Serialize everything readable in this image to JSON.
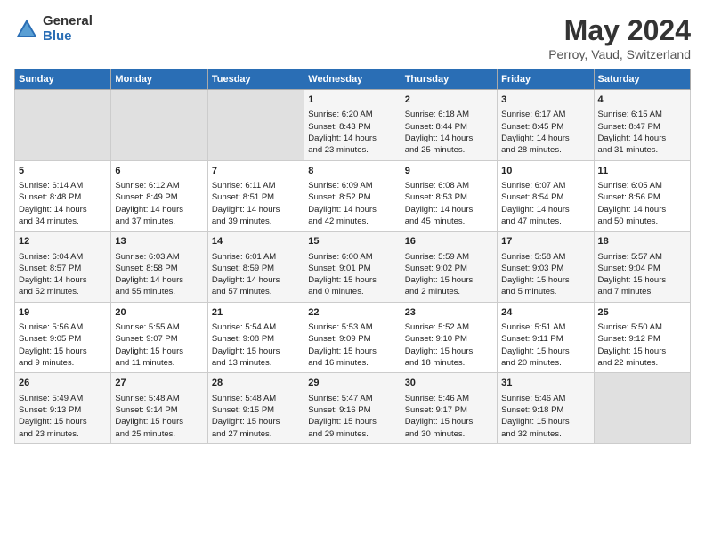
{
  "logo": {
    "general": "General",
    "blue": "Blue"
  },
  "title": "May 2024",
  "subtitle": "Perroy, Vaud, Switzerland",
  "weekdays": [
    "Sunday",
    "Monday",
    "Tuesday",
    "Wednesday",
    "Thursday",
    "Friday",
    "Saturday"
  ],
  "weeks": [
    [
      {
        "day": "",
        "lines": []
      },
      {
        "day": "",
        "lines": []
      },
      {
        "day": "",
        "lines": []
      },
      {
        "day": "1",
        "lines": [
          "Sunrise: 6:20 AM",
          "Sunset: 8:43 PM",
          "Daylight: 14 hours",
          "and 23 minutes."
        ]
      },
      {
        "day": "2",
        "lines": [
          "Sunrise: 6:18 AM",
          "Sunset: 8:44 PM",
          "Daylight: 14 hours",
          "and 25 minutes."
        ]
      },
      {
        "day": "3",
        "lines": [
          "Sunrise: 6:17 AM",
          "Sunset: 8:45 PM",
          "Daylight: 14 hours",
          "and 28 minutes."
        ]
      },
      {
        "day": "4",
        "lines": [
          "Sunrise: 6:15 AM",
          "Sunset: 8:47 PM",
          "Daylight: 14 hours",
          "and 31 minutes."
        ]
      }
    ],
    [
      {
        "day": "5",
        "lines": [
          "Sunrise: 6:14 AM",
          "Sunset: 8:48 PM",
          "Daylight: 14 hours",
          "and 34 minutes."
        ]
      },
      {
        "day": "6",
        "lines": [
          "Sunrise: 6:12 AM",
          "Sunset: 8:49 PM",
          "Daylight: 14 hours",
          "and 37 minutes."
        ]
      },
      {
        "day": "7",
        "lines": [
          "Sunrise: 6:11 AM",
          "Sunset: 8:51 PM",
          "Daylight: 14 hours",
          "and 39 minutes."
        ]
      },
      {
        "day": "8",
        "lines": [
          "Sunrise: 6:09 AM",
          "Sunset: 8:52 PM",
          "Daylight: 14 hours",
          "and 42 minutes."
        ]
      },
      {
        "day": "9",
        "lines": [
          "Sunrise: 6:08 AM",
          "Sunset: 8:53 PM",
          "Daylight: 14 hours",
          "and 45 minutes."
        ]
      },
      {
        "day": "10",
        "lines": [
          "Sunrise: 6:07 AM",
          "Sunset: 8:54 PM",
          "Daylight: 14 hours",
          "and 47 minutes."
        ]
      },
      {
        "day": "11",
        "lines": [
          "Sunrise: 6:05 AM",
          "Sunset: 8:56 PM",
          "Daylight: 14 hours",
          "and 50 minutes."
        ]
      }
    ],
    [
      {
        "day": "12",
        "lines": [
          "Sunrise: 6:04 AM",
          "Sunset: 8:57 PM",
          "Daylight: 14 hours",
          "and 52 minutes."
        ]
      },
      {
        "day": "13",
        "lines": [
          "Sunrise: 6:03 AM",
          "Sunset: 8:58 PM",
          "Daylight: 14 hours",
          "and 55 minutes."
        ]
      },
      {
        "day": "14",
        "lines": [
          "Sunrise: 6:01 AM",
          "Sunset: 8:59 PM",
          "Daylight: 14 hours",
          "and 57 minutes."
        ]
      },
      {
        "day": "15",
        "lines": [
          "Sunrise: 6:00 AM",
          "Sunset: 9:01 PM",
          "Daylight: 15 hours",
          "and 0 minutes."
        ]
      },
      {
        "day": "16",
        "lines": [
          "Sunrise: 5:59 AM",
          "Sunset: 9:02 PM",
          "Daylight: 15 hours",
          "and 2 minutes."
        ]
      },
      {
        "day": "17",
        "lines": [
          "Sunrise: 5:58 AM",
          "Sunset: 9:03 PM",
          "Daylight: 15 hours",
          "and 5 minutes."
        ]
      },
      {
        "day": "18",
        "lines": [
          "Sunrise: 5:57 AM",
          "Sunset: 9:04 PM",
          "Daylight: 15 hours",
          "and 7 minutes."
        ]
      }
    ],
    [
      {
        "day": "19",
        "lines": [
          "Sunrise: 5:56 AM",
          "Sunset: 9:05 PM",
          "Daylight: 15 hours",
          "and 9 minutes."
        ]
      },
      {
        "day": "20",
        "lines": [
          "Sunrise: 5:55 AM",
          "Sunset: 9:07 PM",
          "Daylight: 15 hours",
          "and 11 minutes."
        ]
      },
      {
        "day": "21",
        "lines": [
          "Sunrise: 5:54 AM",
          "Sunset: 9:08 PM",
          "Daylight: 15 hours",
          "and 13 minutes."
        ]
      },
      {
        "day": "22",
        "lines": [
          "Sunrise: 5:53 AM",
          "Sunset: 9:09 PM",
          "Daylight: 15 hours",
          "and 16 minutes."
        ]
      },
      {
        "day": "23",
        "lines": [
          "Sunrise: 5:52 AM",
          "Sunset: 9:10 PM",
          "Daylight: 15 hours",
          "and 18 minutes."
        ]
      },
      {
        "day": "24",
        "lines": [
          "Sunrise: 5:51 AM",
          "Sunset: 9:11 PM",
          "Daylight: 15 hours",
          "and 20 minutes."
        ]
      },
      {
        "day": "25",
        "lines": [
          "Sunrise: 5:50 AM",
          "Sunset: 9:12 PM",
          "Daylight: 15 hours",
          "and 22 minutes."
        ]
      }
    ],
    [
      {
        "day": "26",
        "lines": [
          "Sunrise: 5:49 AM",
          "Sunset: 9:13 PM",
          "Daylight: 15 hours",
          "and 23 minutes."
        ]
      },
      {
        "day": "27",
        "lines": [
          "Sunrise: 5:48 AM",
          "Sunset: 9:14 PM",
          "Daylight: 15 hours",
          "and 25 minutes."
        ]
      },
      {
        "day": "28",
        "lines": [
          "Sunrise: 5:48 AM",
          "Sunset: 9:15 PM",
          "Daylight: 15 hours",
          "and 27 minutes."
        ]
      },
      {
        "day": "29",
        "lines": [
          "Sunrise: 5:47 AM",
          "Sunset: 9:16 PM",
          "Daylight: 15 hours",
          "and 29 minutes."
        ]
      },
      {
        "day": "30",
        "lines": [
          "Sunrise: 5:46 AM",
          "Sunset: 9:17 PM",
          "Daylight: 15 hours",
          "and 30 minutes."
        ]
      },
      {
        "day": "31",
        "lines": [
          "Sunrise: 5:46 AM",
          "Sunset: 9:18 PM",
          "Daylight: 15 hours",
          "and 32 minutes."
        ]
      },
      {
        "day": "",
        "lines": []
      }
    ]
  ]
}
